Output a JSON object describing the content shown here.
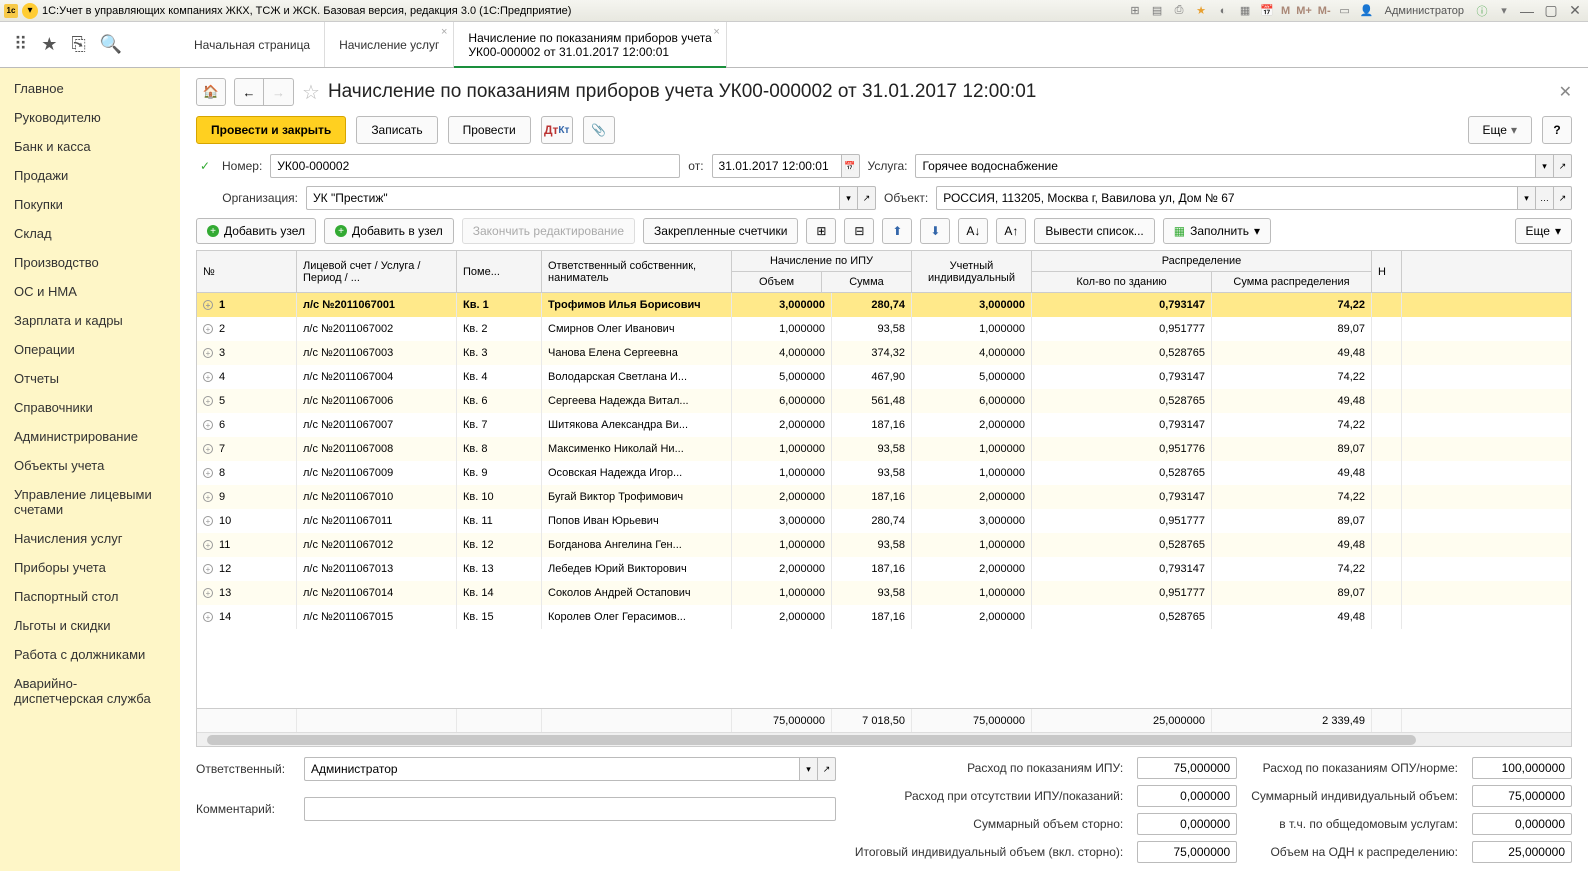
{
  "titlebar": {
    "app_title": "1С:Учет в управляющих компаниях ЖКХ, ТСЖ и ЖСК. Базовая версия, редакция 3.0  (1С:Предприятие)",
    "user": "Администратор",
    "m_items": [
      "M",
      "M+",
      "M-"
    ]
  },
  "tabs": [
    {
      "label": "Начальная страница",
      "active": false,
      "closable": false
    },
    {
      "label": "Начисление услуг",
      "active": false,
      "closable": true
    },
    {
      "label_l1": "Начисление по показаниям приборов учета",
      "label_l2": "УК00-000002 от 31.01.2017 12:00:01",
      "active": true,
      "closable": true
    }
  ],
  "sidebar": [
    "Главное",
    "Руководителю",
    "Банк и касса",
    "Продажи",
    "Покупки",
    "Склад",
    "Производство",
    "ОС и НМА",
    "Зарплата и кадры",
    "Операции",
    "Отчеты",
    "Справочники",
    "Администрирование",
    "Объекты учета",
    "Управление лицевыми счетами",
    "Начисления услуг",
    "Приборы учета",
    "Паспортный стол",
    "Льготы и скидки",
    "Работа с должниками",
    "Аварийно-диспетчерская служба"
  ],
  "page": {
    "title": "Начисление по показаниям приборов учета УК00-000002 от 31.01.2017 12:00:01",
    "actions": {
      "post_close": "Провести и закрыть",
      "write": "Записать",
      "post": "Провести",
      "more": "Еще"
    },
    "form": {
      "number_label": "Номер:",
      "number": "УК00-000002",
      "from_label": "от:",
      "date": "31.01.2017 12:00:01",
      "service_label": "Услуга:",
      "service": "Горячее водоснабжение",
      "org_label": "Организация:",
      "org": "УК \"Престиж\"",
      "object_label": "Объект:",
      "object": "РОССИЯ, 113205, Москва г, Вавилова ул, Дом № 67"
    },
    "tbltoolbar": {
      "add_node": "Добавить узел",
      "add_into": "Добавить в узел",
      "finish_edit": "Закончить редактирование",
      "pinned": "Закрепленные счетчики",
      "output": "Вывести список...",
      "fill": "Заполнить",
      "more": "Еще"
    },
    "columns": {
      "no": "№",
      "account": "Лицевой счет / Услуга / Период / ...",
      "room": "Поме...",
      "owner": "Ответственный собственник, наниматель",
      "ipu_group": "Начисление по ИПУ",
      "ipu_vol": "Объем",
      "ipu_sum": "Сумма",
      "individual": "Учетный индивидуальный",
      "dist_group": "Распределение",
      "dist_qty": "Кол-во по зданию",
      "dist_sum": "Сумма распределения",
      "last": "Н"
    },
    "rows": [
      {
        "no": "1",
        "acc": "л/с №2011067001",
        "room": "Кв. 1",
        "owner": "Трофимов Илья Борисович",
        "vol": "3,000000",
        "sum": "280,74",
        "ind": "3,000000",
        "qty": "0,793147",
        "dsum": "74,22",
        "sel": true
      },
      {
        "no": "2",
        "acc": "л/с №2011067002",
        "room": "Кв. 2",
        "owner": "Смирнов Олег Иванович",
        "vol": "1,000000",
        "sum": "93,58",
        "ind": "1,000000",
        "qty": "0,951777",
        "dsum": "89,07"
      },
      {
        "no": "3",
        "acc": "л/с №2011067003",
        "room": "Кв. 3",
        "owner": "Чанова Елена Сергеевна",
        "vol": "4,000000",
        "sum": "374,32",
        "ind": "4,000000",
        "qty": "0,528765",
        "dsum": "49,48"
      },
      {
        "no": "4",
        "acc": "л/с №2011067004",
        "room": "Кв. 4",
        "owner": "Володарская Светлана И...",
        "vol": "5,000000",
        "sum": "467,90",
        "ind": "5,000000",
        "qty": "0,793147",
        "dsum": "74,22"
      },
      {
        "no": "5",
        "acc": "л/с №2011067006",
        "room": "Кв. 6",
        "owner": "Сергеева Надежда Витал...",
        "vol": "6,000000",
        "sum": "561,48",
        "ind": "6,000000",
        "qty": "0,528765",
        "dsum": "49,48"
      },
      {
        "no": "6",
        "acc": "л/с №2011067007",
        "room": "Кв. 7",
        "owner": "Шитякова Александра Ви...",
        "vol": "2,000000",
        "sum": "187,16",
        "ind": "2,000000",
        "qty": "0,793147",
        "dsum": "74,22"
      },
      {
        "no": "7",
        "acc": "л/с №2011067008",
        "room": "Кв. 8",
        "owner": "Максименко Николай Ни...",
        "vol": "1,000000",
        "sum": "93,58",
        "ind": "1,000000",
        "qty": "0,951776",
        "dsum": "89,07"
      },
      {
        "no": "8",
        "acc": "л/с №2011067009",
        "room": "Кв. 9",
        "owner": "Осовская Надежда Игор...",
        "vol": "1,000000",
        "sum": "93,58",
        "ind": "1,000000",
        "qty": "0,528765",
        "dsum": "49,48"
      },
      {
        "no": "9",
        "acc": "л/с №2011067010",
        "room": "Кв. 10",
        "owner": "Бугай Виктор Трофимович",
        "vol": "2,000000",
        "sum": "187,16",
        "ind": "2,000000",
        "qty": "0,793147",
        "dsum": "74,22"
      },
      {
        "no": "10",
        "acc": "л/с №2011067011",
        "room": "Кв. 11",
        "owner": "Попов Иван Юрьевич",
        "vol": "3,000000",
        "sum": "280,74",
        "ind": "3,000000",
        "qty": "0,951777",
        "dsum": "89,07"
      },
      {
        "no": "11",
        "acc": "л/с №2011067012",
        "room": "Кв. 12",
        "owner": "Богданова Ангелина Ген...",
        "vol": "1,000000",
        "sum": "93,58",
        "ind": "1,000000",
        "qty": "0,528765",
        "dsum": "49,48"
      },
      {
        "no": "12",
        "acc": "л/с №2011067013",
        "room": "Кв. 13",
        "owner": "Лебедев Юрий Викторович",
        "vol": "2,000000",
        "sum": "187,16",
        "ind": "2,000000",
        "qty": "0,793147",
        "dsum": "74,22"
      },
      {
        "no": "13",
        "acc": "л/с №2011067014",
        "room": "Кв. 14",
        "owner": "Соколов Андрей Остапович",
        "vol": "1,000000",
        "sum": "93,58",
        "ind": "1,000000",
        "qty": "0,951777",
        "dsum": "89,07"
      },
      {
        "no": "14",
        "acc": "л/с №2011067015",
        "room": "Кв. 15",
        "owner": "Королев Олег Герасимов...",
        "vol": "2,000000",
        "sum": "187,16",
        "ind": "2,000000",
        "qty": "0,528765",
        "dsum": "49,48"
      }
    ],
    "totals": {
      "vol": "75,000000",
      "sum": "7 018,50",
      "ind": "75,000000",
      "qty": "25,000000",
      "dsum": "2 339,49"
    },
    "stats": {
      "ipu_label": "Расход по показаниям ИПУ:",
      "ipu": "75,000000",
      "opu_label": "Расход по показаниям ОПУ/норме:",
      "opu": "100,000000",
      "noipu_label": "Расход при отсутствии ИПУ/показаний:",
      "noipu": "0,000000",
      "sumind_label": "Суммарный индивидуальный объем:",
      "sumind": "75,000000",
      "storno_label": "Суммарный объем сторно:",
      "storno": "0,000000",
      "common_label": "в т.ч. по общедомовым услугам:",
      "common": "0,000000",
      "total_label": "Итоговый индивидуальный объем (вкл. сторно):",
      "total": "75,000000",
      "odn_label": "Объем на ОДН к распределению:",
      "odn": "25,000000"
    },
    "bottom": {
      "responsible_label": "Ответственный:",
      "responsible": "Администратор",
      "comment_label": "Комментарий:"
    }
  }
}
